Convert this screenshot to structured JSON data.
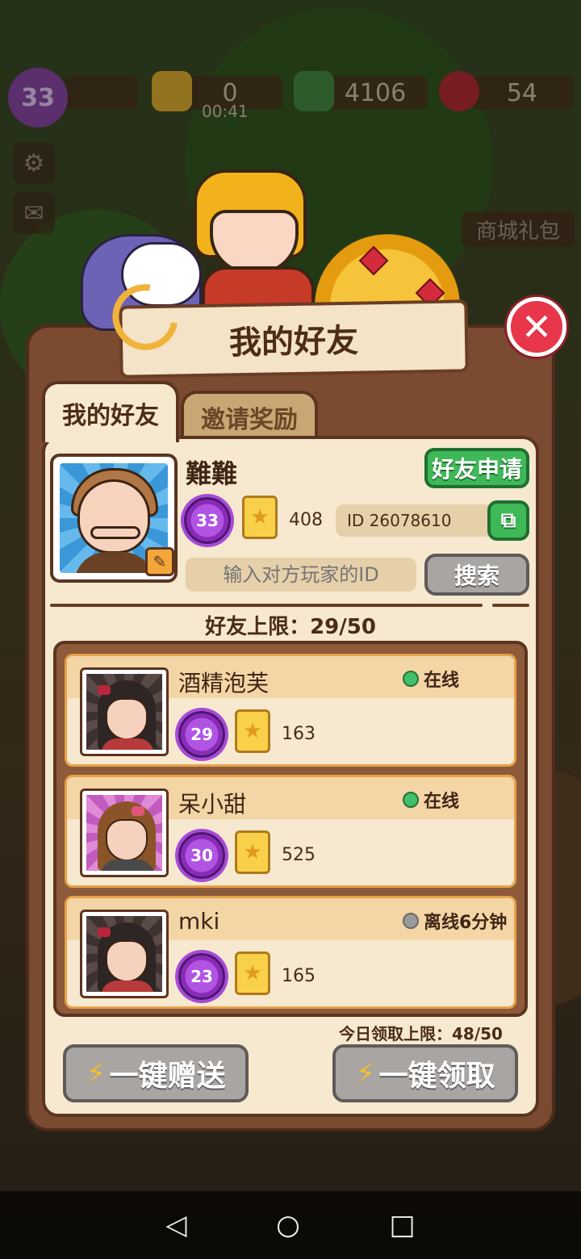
{
  "hud": {
    "level": "33",
    "energy": "0",
    "energy_timer": "00:41",
    "cash": "4106",
    "gems": "54",
    "shop_label": "商城礼包"
  },
  "dialog": {
    "title": "我的好友",
    "tabs": [
      "我的好友",
      "邀请奖励"
    ],
    "close_symbol": "✕"
  },
  "profile": {
    "nickname": "難難",
    "level": "33",
    "stars": "408",
    "id_text": "ID 26078610",
    "friend_request_label": "好友申请",
    "copy_icon": "copy-icon",
    "search_placeholder": "输入对方玩家的ID",
    "search_label": "搜索"
  },
  "friend_limit": "好友上限：29/50",
  "friends": [
    {
      "name": "酒精泡芙",
      "level": "29",
      "stars": "163",
      "status": "在线",
      "online": true
    },
    {
      "name": "呆小甜",
      "level": "30",
      "stars": "525",
      "status": "在线",
      "online": true
    },
    {
      "name": "mki",
      "level": "23",
      "stars": "165",
      "status": "离线6分钟",
      "online": false
    }
  ],
  "daily_claim_limit": "今日领取上限：48/50",
  "actions": {
    "send_all_label": "一键赠送",
    "claim_all_label": "一键领取"
  },
  "colors": {
    "online": "#3fc06a",
    "offline": "#9a9a9a",
    "accent_green": "#3fb858",
    "close_red": "#e8364a"
  }
}
